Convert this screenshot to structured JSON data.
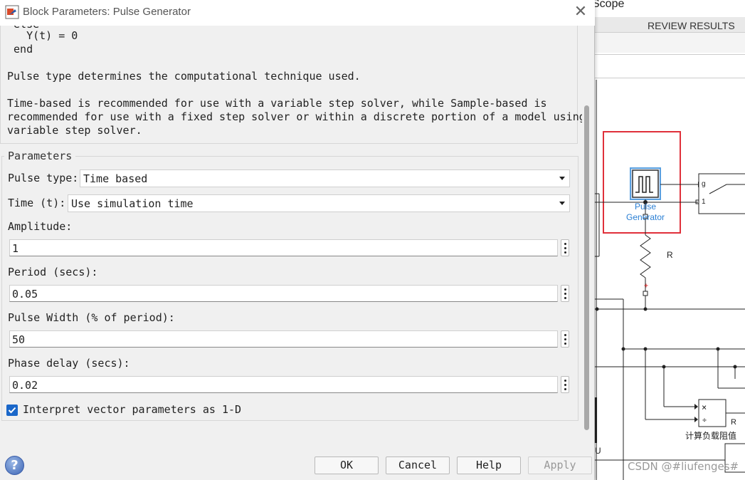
{
  "background": {
    "scope_label": "Scope",
    "review_tab": "REVIEW RESULTS",
    "block_label_line1": "Pulse",
    "block_label_line2": "Generator",
    "resistor_label": "R",
    "calc_label": "计算负载阻值",
    "calc_port_label": "R",
    "switch_port_g": "g",
    "switch_port_1": "1",
    "partial_label": "U",
    "watermark": "CSDN @#liufenges#"
  },
  "dialog": {
    "title": "Block Parameters: Pulse Generator",
    "close_glyph": "✕",
    "description": {
      "code_line_partial": " else",
      "code_line_1": "   Y(t) = 0",
      "code_line_2": " end",
      "para1": "Pulse type determines the computational technique used.",
      "para2_line1": "Time-based is recommended for use with a variable step solver, while Sample-based is",
      "para2_line2": "recommended for use with a fixed step solver or within a discrete portion of a model using a",
      "para2_line3": "variable step solver."
    },
    "parameters": {
      "legend": "Parameters",
      "pulse_type_label": "Pulse type:",
      "pulse_type_value": "Time based",
      "time_label": "Time (t):",
      "time_value": "Use simulation time",
      "amplitude_label": "Amplitude:",
      "amplitude_value": "1",
      "period_label": "Period (secs):",
      "period_value": "0.05",
      "pulse_width_label": "Pulse Width (% of period):",
      "pulse_width_value": "50",
      "phase_delay_label": "Phase delay (secs):",
      "phase_delay_value": "0.02",
      "interpret_label": "Interpret vector parameters as 1-D",
      "interpret_checked": true
    },
    "buttons": {
      "help_icon_glyph": "?",
      "ok": "OK",
      "cancel": "Cancel",
      "help": "Help",
      "apply": "Apply"
    }
  }
}
